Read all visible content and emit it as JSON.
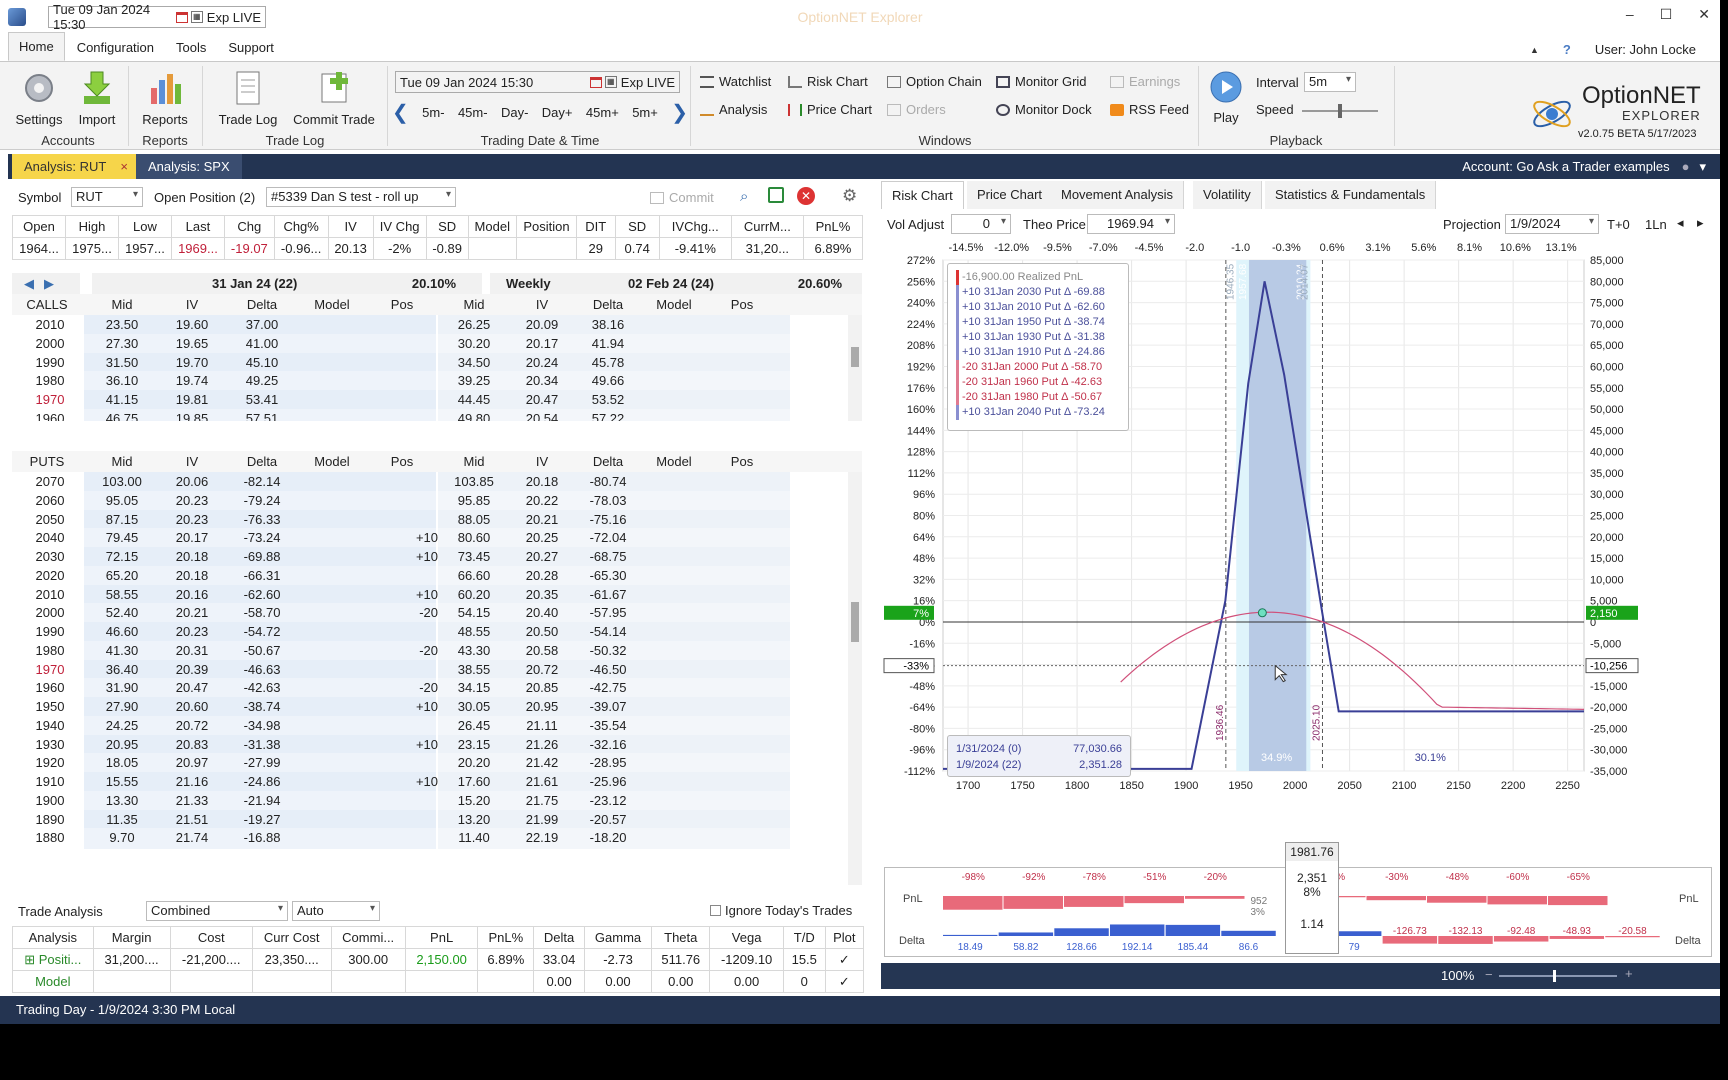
{
  "titlebar": {
    "datetime": "Tue 09 Jan 2024 15:30",
    "exp": "Exp LIVE",
    "app_title": "OptionNET Explorer",
    "min": "–",
    "max": "☐",
    "close": "✕"
  },
  "menu": {
    "tabs": [
      "Home",
      "Configuration",
      "Tools",
      "Support"
    ],
    "user": "User: John Locke",
    "up": "▲",
    "help": "?"
  },
  "ribbon": {
    "accounts": {
      "label": "Accounts",
      "settings": "Settings",
      "import": "Import"
    },
    "reports": {
      "label": "Reports",
      "reports": "Reports"
    },
    "tradelog": {
      "label": "Trade Log",
      "trade_log": "Trade Log",
      "commit_trade": "Commit Trade"
    },
    "trading": {
      "label": "Trading Date & Time",
      "datetime": "Tue 09 Jan 2024 15:30",
      "exp": "Exp LIVE",
      "steps": [
        "5m-",
        "45m-",
        "Day-",
        "Day+",
        "45m+",
        "5m+"
      ]
    },
    "windows": {
      "label": "Windows",
      "items": [
        "Watchlist",
        "Risk Chart",
        "Option Chain",
        "Monitor Grid",
        "Earnings",
        "Analysis",
        "Price Chart",
        "Orders",
        "Monitor Dock",
        "RSS Feed"
      ]
    },
    "playback": {
      "label": "Playback",
      "play": "Play",
      "interval_label": "Interval",
      "interval": "5m",
      "speed_label": "Speed"
    },
    "brand": {
      "name": "OptionNET",
      "sub": "EXPLORER",
      "version": "v2.0.75 BETA 5/17/2023"
    }
  },
  "analysis_tabs": [
    "Analysis: RUT",
    "Analysis: SPX"
  ],
  "account": "Account: Go Ask a Trader examples",
  "left": {
    "symbol_label": "Symbol",
    "symbol": "RUT",
    "openpos_label": "Open Position (2)",
    "openpos": "#5339 Dan S test - roll up",
    "commit": "Commit",
    "quote_headers": [
      "Open",
      "High",
      "Low",
      "Last",
      "Chg",
      "Chg%",
      "IV",
      "IV Chg",
      "SD",
      "Model",
      "Position"
    ],
    "quote_values": [
      "1964...",
      "1975...",
      "1957...",
      "1969...",
      "-19.07",
      "-0.96...",
      "20.13",
      "-2%",
      "-0.89",
      "",
      ""
    ],
    "quote2_headers": [
      "DIT",
      "SD",
      "IVChg...",
      "CurrM...",
      "PnL%"
    ],
    "quote2_values": [
      "29",
      "0.74",
      "-9.41%",
      "31,20...",
      "6.89%"
    ],
    "exp1": {
      "title": "31 Jan 24 (22)",
      "iv": "20.10%"
    },
    "exp2": {
      "label": "Weekly",
      "title": "02 Feb 24 (24)",
      "iv": "20.60%"
    },
    "calls_label": "CALLS",
    "puts_label": "PUTS",
    "col_headers": [
      "Mid",
      "IV",
      "Delta",
      "Model",
      "Pos"
    ],
    "calls": [
      [
        "2010",
        "23.50",
        "19.60",
        "37.00",
        "",
        "",
        "26.25",
        "20.09",
        "38.16",
        "",
        ""
      ],
      [
        "2000",
        "27.30",
        "19.65",
        "41.00",
        "",
        "",
        "30.20",
        "20.17",
        "41.94",
        "",
        ""
      ],
      [
        "1990",
        "31.50",
        "19.70",
        "45.10",
        "",
        "",
        "34.50",
        "20.24",
        "45.78",
        "",
        ""
      ],
      [
        "1980",
        "36.10",
        "19.74",
        "49.25",
        "",
        "",
        "39.25",
        "20.34",
        "49.66",
        "",
        ""
      ],
      [
        "1970",
        "41.15",
        "19.81",
        "53.41",
        "",
        "",
        "44.45",
        "20.47",
        "53.52",
        "",
        ""
      ],
      [
        "1960",
        "46.75",
        "19.85",
        "57.51",
        "",
        "",
        "49.80",
        "20.54",
        "57.22",
        "",
        ""
      ]
    ],
    "puts": [
      [
        "2070",
        "103.00",
        "20.06",
        "-82.14",
        "",
        "",
        "103.85",
        "20.18",
        "-80.74",
        "",
        ""
      ],
      [
        "2060",
        "95.05",
        "20.23",
        "-79.24",
        "",
        "",
        "95.85",
        "20.22",
        "-78.03",
        "",
        ""
      ],
      [
        "2050",
        "87.15",
        "20.23",
        "-76.33",
        "",
        "",
        "88.05",
        "20.21",
        "-75.16",
        "",
        ""
      ],
      [
        "2040",
        "79.45",
        "20.17",
        "-73.24",
        "",
        "+10",
        "80.60",
        "20.25",
        "-72.04",
        "",
        ""
      ],
      [
        "2030",
        "72.15",
        "20.18",
        "-69.88",
        "",
        "+10",
        "73.45",
        "20.27",
        "-68.75",
        "",
        ""
      ],
      [
        "2020",
        "65.20",
        "20.18",
        "-66.31",
        "",
        "",
        "66.60",
        "20.28",
        "-65.30",
        "",
        ""
      ],
      [
        "2010",
        "58.55",
        "20.16",
        "-62.60",
        "",
        "+10",
        "60.20",
        "20.35",
        "-61.67",
        "",
        ""
      ],
      [
        "2000",
        "52.40",
        "20.21",
        "-58.70",
        "",
        "-20",
        "54.15",
        "20.40",
        "-57.95",
        "",
        ""
      ],
      [
        "1990",
        "46.60",
        "20.23",
        "-54.72",
        "",
        "",
        "48.55",
        "20.50",
        "-54.14",
        "",
        ""
      ],
      [
        "1980",
        "41.30",
        "20.31",
        "-50.67",
        "",
        "-20",
        "43.30",
        "20.58",
        "-50.32",
        "",
        ""
      ],
      [
        "1970",
        "36.40",
        "20.39",
        "-46.63",
        "",
        "",
        "38.55",
        "20.72",
        "-46.50",
        "",
        ""
      ],
      [
        "1960",
        "31.90",
        "20.47",
        "-42.63",
        "",
        "-20",
        "34.15",
        "20.85",
        "-42.75",
        "",
        ""
      ],
      [
        "1950",
        "27.90",
        "20.60",
        "-38.74",
        "",
        "+10",
        "30.05",
        "20.95",
        "-39.07",
        "",
        ""
      ],
      [
        "1940",
        "24.25",
        "20.72",
        "-34.98",
        "",
        "",
        "26.45",
        "21.11",
        "-35.54",
        "",
        ""
      ],
      [
        "1930",
        "20.95",
        "20.83",
        "-31.38",
        "",
        "+10",
        "23.15",
        "21.26",
        "-32.16",
        "",
        ""
      ],
      [
        "1920",
        "18.05",
        "20.97",
        "-27.99",
        "",
        "",
        "20.20",
        "21.42",
        "-28.95",
        "",
        ""
      ],
      [
        "1910",
        "15.55",
        "21.16",
        "-24.86",
        "",
        "+10",
        "17.60",
        "21.61",
        "-25.96",
        "",
        ""
      ],
      [
        "1900",
        "13.30",
        "21.33",
        "-21.94",
        "",
        "",
        "15.20",
        "21.75",
        "-23.12",
        "",
        ""
      ],
      [
        "1890",
        "11.35",
        "21.51",
        "-19.27",
        "",
        "",
        "13.20",
        "21.99",
        "-20.57",
        "",
        ""
      ],
      [
        "1880",
        "9.70",
        "21.74",
        "-16.88",
        "",
        "",
        "11.40",
        "22.19",
        "-18.20",
        "",
        ""
      ]
    ],
    "trade_analysis_label": "Trade Analysis",
    "ta_mode": "Combined",
    "ta_auto": "Auto",
    "ignore_label": "Ignore Today's Trades",
    "summary_headers": [
      "Analysis",
      "Margin",
      "Cost",
      "Curr Cost",
      "Commi...",
      "PnL",
      "PnL%",
      "Delta",
      "Gamma",
      "Theta",
      "Vega",
      "T/D",
      "Plot"
    ],
    "summary_rows": [
      [
        "Positi...",
        "31,200....",
        "-21,200....",
        "23,350....",
        "300.00",
        "2,150.00",
        "6.89%",
        "33.04",
        "-2.73",
        "511.76",
        "-1209.10",
        "15.5",
        "✓"
      ],
      [
        "Model",
        "",
        "",
        "",
        "",
        "",
        "",
        "0.00",
        "0.00",
        "0.00",
        "0.00",
        "0",
        "✓"
      ]
    ]
  },
  "right": {
    "tabs": [
      "Risk Chart",
      "Price Chart",
      "Movement Analysis",
      "Volatility",
      "Statistics & Fundamentals"
    ],
    "vol_adjust_label": "Vol Adjust",
    "vol_adjust": "0",
    "theo_label": "Theo Price",
    "theo": "1969.94",
    "proj_label": "Projection",
    "proj": "1/9/2024",
    "t0": "T+0",
    "lln": "1Ln",
    "top_pct": [
      "-14.5%",
      "-12.0%",
      "-9.5%",
      "-7.0%",
      "-4.5%",
      "-2.0",
      "-1.0",
      "-0.3%",
      "0.6%",
      "3.1%",
      "5.6%",
      "8.1%",
      "10.6%",
      "13.1%"
    ],
    "y_left": [
      "272%",
      "256%",
      "240%",
      "224%",
      "208%",
      "192%",
      "176%",
      "160%",
      "144%",
      "128%",
      "112%",
      "96%",
      "80%",
      "64%",
      "48%",
      "32%",
      "16%",
      "0%",
      "-16%",
      "-33%",
      "-48%",
      "-64%",
      "-80%",
      "-96%",
      "-112%"
    ],
    "y_right": [
      "85,000",
      "80,000",
      "75,000",
      "70,000",
      "65,000",
      "60,000",
      "55,000",
      "50,000",
      "45,000",
      "40,000",
      "35,000",
      "30,000",
      "25,000",
      "20,000",
      "15,000",
      "10,000",
      "5,000",
      "0",
      "-5,000",
      "-10,256",
      "-15,000",
      "-20,000",
      "-25,000",
      "-30,000",
      "-35,000"
    ],
    "x_ticks": [
      "1700",
      "1750",
      "1800",
      "1850",
      "1900",
      "1950",
      "2000",
      "2050",
      "2100",
      "2150",
      "2200",
      "2250"
    ],
    "flag_left": "7%",
    "flag_right": "2,150",
    "mark_left": "-33%",
    "mark_right": "-10,256",
    "legend": [
      "-16,900.00 Realized PnL",
      "+10 31Jan 2030 Put Δ  -69.88",
      "+10 31Jan 2010 Put Δ  -62.60",
      "+10 31Jan 1950 Put Δ  -38.74",
      "+10 31Jan 1930 Put Δ  -31.38",
      "+10 31Jan 1910 Put Δ  -24.86",
      "-20 31Jan 2000 Put Δ  -58.70",
      "-20 31Jan 1960 Put Δ  -42.63",
      "-20 31Jan 1980 Put Δ  -50.67",
      "+10 31Jan 2040 Put Δ  -73.24"
    ],
    "box": [
      [
        "1/31/2024 (0)",
        "77,030.66"
      ],
      [
        "1/9/2024 (22)",
        "2,351.28"
      ]
    ],
    "vlabels": [
      "1936.46",
      "2025.10",
      "1957.68",
      "2010.24",
      "1946.35",
      "2014.07"
    ],
    "pct_low": "34.9%",
    "pct_right": "30.1%",
    "cursor_price": "1981.76",
    "cursor_pnl": "2,351",
    "cursor_pct": "8%",
    "cursor_delta": "1.14",
    "pnl_label": "PnL",
    "delta_label": "Delta",
    "pnl_bars": [
      [
        "-98%",
        "-30581"
      ],
      [
        "-92%",
        "-28784"
      ],
      [
        "-78%",
        "-24183"
      ],
      [
        "-51%",
        "-16003"
      ],
      [
        "-20%",
        "-6164"
      ],
      [
        "952",
        "3%"
      ],
      [
        "-9%",
        "-2664"
      ],
      [
        "-30%",
        "-9416"
      ],
      [
        "-48%",
        "-15122"
      ],
      [
        "-60%",
        "-18614"
      ],
      [
        "-65%",
        "-20280"
      ]
    ],
    "delta_bars": [
      "18.49",
      "58.82",
      "128.66",
      "192.14",
      "185.44",
      "86.6",
      "79",
      "-126.73",
      "-132.13",
      "-92.48",
      "-48.93",
      "-20.58"
    ],
    "zoom": "100%"
  },
  "status": "Trading Day - 1/9/2024 3:30 PM Local",
  "colors": {
    "accent": "#233452",
    "tab_active": "#f6d54a",
    "pnl_line": "#3a3f96",
    "t0_line": "#d0507a",
    "green_flag": "#1aa31a"
  }
}
